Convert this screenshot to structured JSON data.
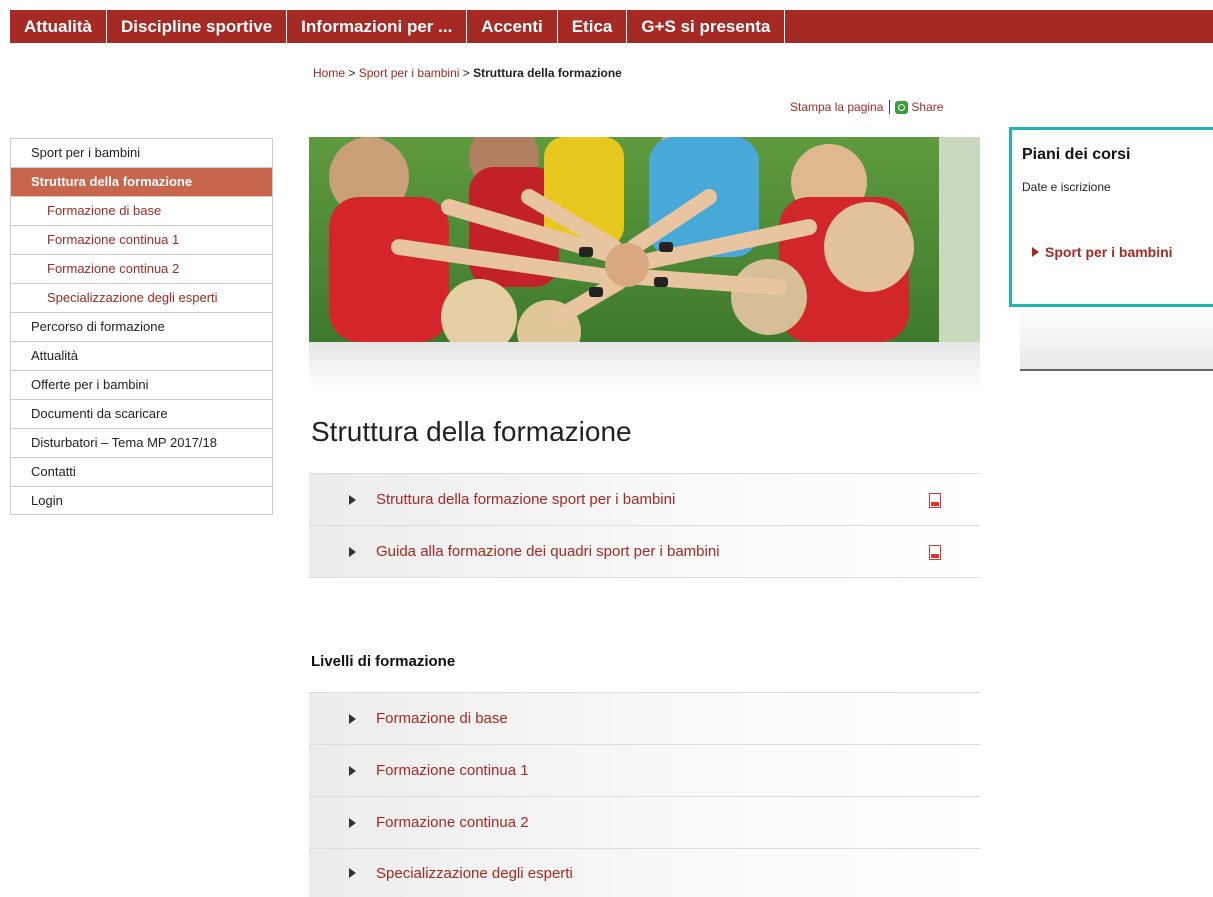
{
  "topnav": [
    "Attualità",
    "Discipline sportive",
    "Informazioni per ...",
    "Accenti",
    "Etica",
    "G+S si presenta"
  ],
  "breadcrumb": {
    "home": "Home",
    "sep": ">",
    "parent": "Sport per i bambini",
    "current": "Struttura della formazione"
  },
  "tools": {
    "print": "Stampa la pagina",
    "share": "Share"
  },
  "leftnav": [
    {
      "label": "Sport per i bambini",
      "kind": "top"
    },
    {
      "label": "Struttura della formazione",
      "kind": "active"
    },
    {
      "label": "Formazione di base",
      "kind": "sub"
    },
    {
      "label": "Formazione continua 1",
      "kind": "sub"
    },
    {
      "label": "Formazione continua 2",
      "kind": "sub"
    },
    {
      "label": "Specializzazione degli esperti",
      "kind": "sub"
    },
    {
      "label": "Percorso di formazione",
      "kind": "top"
    },
    {
      "label": "Attualità",
      "kind": "top"
    },
    {
      "label": "Offerte per i bambini",
      "kind": "top"
    },
    {
      "label": "Documenti da scaricare",
      "kind": "top"
    },
    {
      "label": "Disturbatori – Tema MP 2017/18",
      "kind": "top"
    },
    {
      "label": "Contatti",
      "kind": "top"
    },
    {
      "label": "Login",
      "kind": "top"
    }
  ],
  "main": {
    "title": "Struttura della formazione",
    "documents": [
      "Struttura della formazione sport per i bambini",
      "Guida alla formazione dei quadri sport per i bambini"
    ],
    "levels_title": "Livelli di formazione",
    "levels": [
      "Formazione di base",
      "Formazione continua 1",
      "Formazione continua 2",
      "Specializzazione degli esperti"
    ]
  },
  "sidebox": {
    "title": "Piani dei corsi",
    "subtitle": "Date e iscrizione",
    "link": "Sport per i bambini"
  },
  "colors": {
    "brand": "#a52a23",
    "active": "#c8664d",
    "highlight": "#1fb6b0"
  }
}
